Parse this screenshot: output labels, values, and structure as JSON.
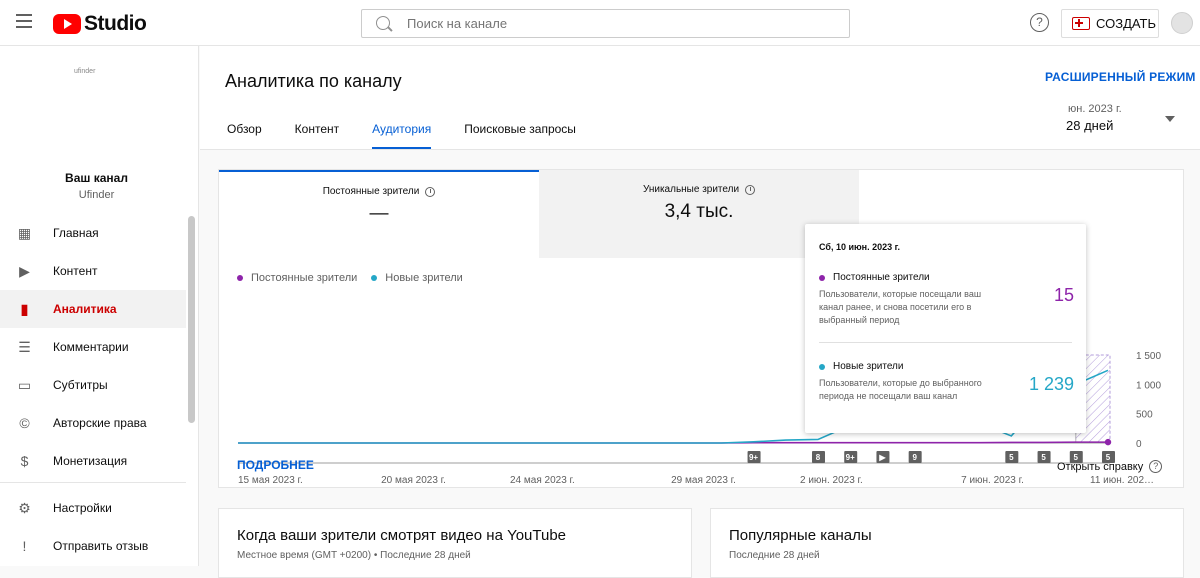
{
  "topbar": {
    "logo_text": "Studio",
    "search_placeholder": "Поиск на канале",
    "help_glyph": "?",
    "create_label": "СОЗДАТЬ"
  },
  "sidebar": {
    "channel_image_alt": "ufinder",
    "channel_title": "Ваш канал",
    "channel_name": "Ufinder",
    "items": [
      {
        "label": "Главная",
        "icon": "dashboard-icon",
        "glyph": "▦"
      },
      {
        "label": "Контент",
        "icon": "content-icon",
        "glyph": "▶"
      },
      {
        "label": "Аналитика",
        "icon": "analytics-icon",
        "glyph": "▮"
      },
      {
        "label": "Комментарии",
        "icon": "comments-icon",
        "glyph": "☰"
      },
      {
        "label": "Субтитры",
        "icon": "subtitles-icon",
        "glyph": "▭"
      },
      {
        "label": "Авторские права",
        "icon": "copyright-icon",
        "glyph": "©"
      },
      {
        "label": "Монетизация",
        "icon": "monetization-icon",
        "glyph": "$"
      },
      {
        "label": "Настройки",
        "icon": "settings-icon",
        "glyph": "⚙"
      },
      {
        "label": "Отправить отзыв",
        "icon": "feedback-icon",
        "glyph": "!"
      }
    ]
  },
  "header": {
    "title": "Аналитика по каналу",
    "advanced_mode": "РАСШИРЕННЫЙ РЕЖИМ",
    "tabs": [
      "Обзор",
      "Контент",
      "Аудитория",
      "Поисковые запросы"
    ],
    "active_tab": 2,
    "date_range_line1": "юн. 2023 г.",
    "date_range_line2": "28 дней"
  },
  "metrics": [
    {
      "label": "Постоянные зрители",
      "value": "—"
    },
    {
      "label": "Уникальные зрители",
      "value": "3,4 тыс."
    }
  ],
  "legend": [
    {
      "name": "Постоянные зрители",
      "color": "#8e24aa"
    },
    {
      "name": "Новые зрители",
      "color": "#25a7c7"
    }
  ],
  "chart_data": {
    "type": "line",
    "x": [
      "15 мая",
      "16 мая",
      "17 мая",
      "18 мая",
      "19 мая",
      "20 мая",
      "21 мая",
      "22 мая",
      "23 мая",
      "24 мая",
      "25 мая",
      "26 мая",
      "27 мая",
      "28 мая",
      "29 мая",
      "30 мая",
      "31 мая",
      "1 июн.",
      "2 июн.",
      "3 июн.",
      "4 июн.",
      "5 июн.",
      "6 июн.",
      "7 июн.",
      "8 июн.",
      "9 июн.",
      "10 июн.",
      "11 июн."
    ],
    "series": [
      {
        "name": "Постоянные зрители",
        "color": "#8e24aa",
        "values": [
          0,
          0,
          0,
          0,
          0,
          0,
          0,
          0,
          0,
          0,
          0,
          0,
          0,
          0,
          0,
          0,
          5,
          5,
          5,
          5,
          5,
          5,
          5,
          5,
          10,
          10,
          15,
          15
        ]
      },
      {
        "name": "Новые зрители",
        "color": "#25a7c7",
        "values": [
          0,
          0,
          0,
          0,
          0,
          0,
          0,
          0,
          0,
          0,
          0,
          0,
          0,
          0,
          0,
          0,
          20,
          50,
          60,
          300,
          280,
          220,
          400,
          340,
          120,
          750,
          1000,
          1239
        ]
      }
    ],
    "ylim": [
      0,
      1500
    ],
    "yticks": [
      "1 500",
      "1 000",
      "500",
      "0"
    ],
    "ytick_values": [
      1500,
      1000,
      500,
      0
    ],
    "xtick_labels": [
      {
        "label": "15 мая 2023 г.",
        "index": 0
      },
      {
        "label": "20 мая 2023 г.",
        "index": 5
      },
      {
        "label": "24 мая 2023 г.",
        "index": 9
      },
      {
        "label": "29 мая 2023 г.",
        "index": 14
      },
      {
        "label": "2 июн. 2023 г.",
        "index": 18
      },
      {
        "label": "7 июн. 2023 г.",
        "index": 23
      },
      {
        "label": "11 июн. 202…",
        "index": 27
      }
    ],
    "markers": [
      {
        "label": "9+",
        "index": 16
      },
      {
        "label": "8",
        "index": 18
      },
      {
        "label": "9+",
        "index": 19
      },
      {
        "label": "▶",
        "index": 20
      },
      {
        "label": "9",
        "index": 21
      },
      {
        "label": "5",
        "index": 24
      },
      {
        "label": "5",
        "index": 25
      },
      {
        "label": "5",
        "index": 26
      },
      {
        "label": "5",
        "index": 27
      }
    ],
    "highlight_from_index": 26
  },
  "card_footer": {
    "more": "ПОДРОБНЕЕ",
    "help": "Открыть справку",
    "help_glyph": "?"
  },
  "tooltip": {
    "date": "Сб, 10 июн. 2023 г.",
    "returning_title": "Постоянные зрители",
    "returning_desc": "Пользователи, которые посещали ваш канал ранее, и снова посетили его в выбранный период",
    "returning_value": "15",
    "returning_color": "#8e24aa",
    "new_title": "Новые зрители",
    "new_desc": "Пользователи, которые до выбранного периода не посещали ваш канал",
    "new_value": "1 239",
    "new_color": "#25a7c7"
  },
  "bottom": [
    {
      "title": "Когда ваши зрители смотрят видео на YouTube",
      "subtitle": "Местное время (GMT +0200) • Последние 28 дней"
    },
    {
      "title": "Популярные каналы",
      "subtitle": "Последние 28 дней"
    }
  ]
}
